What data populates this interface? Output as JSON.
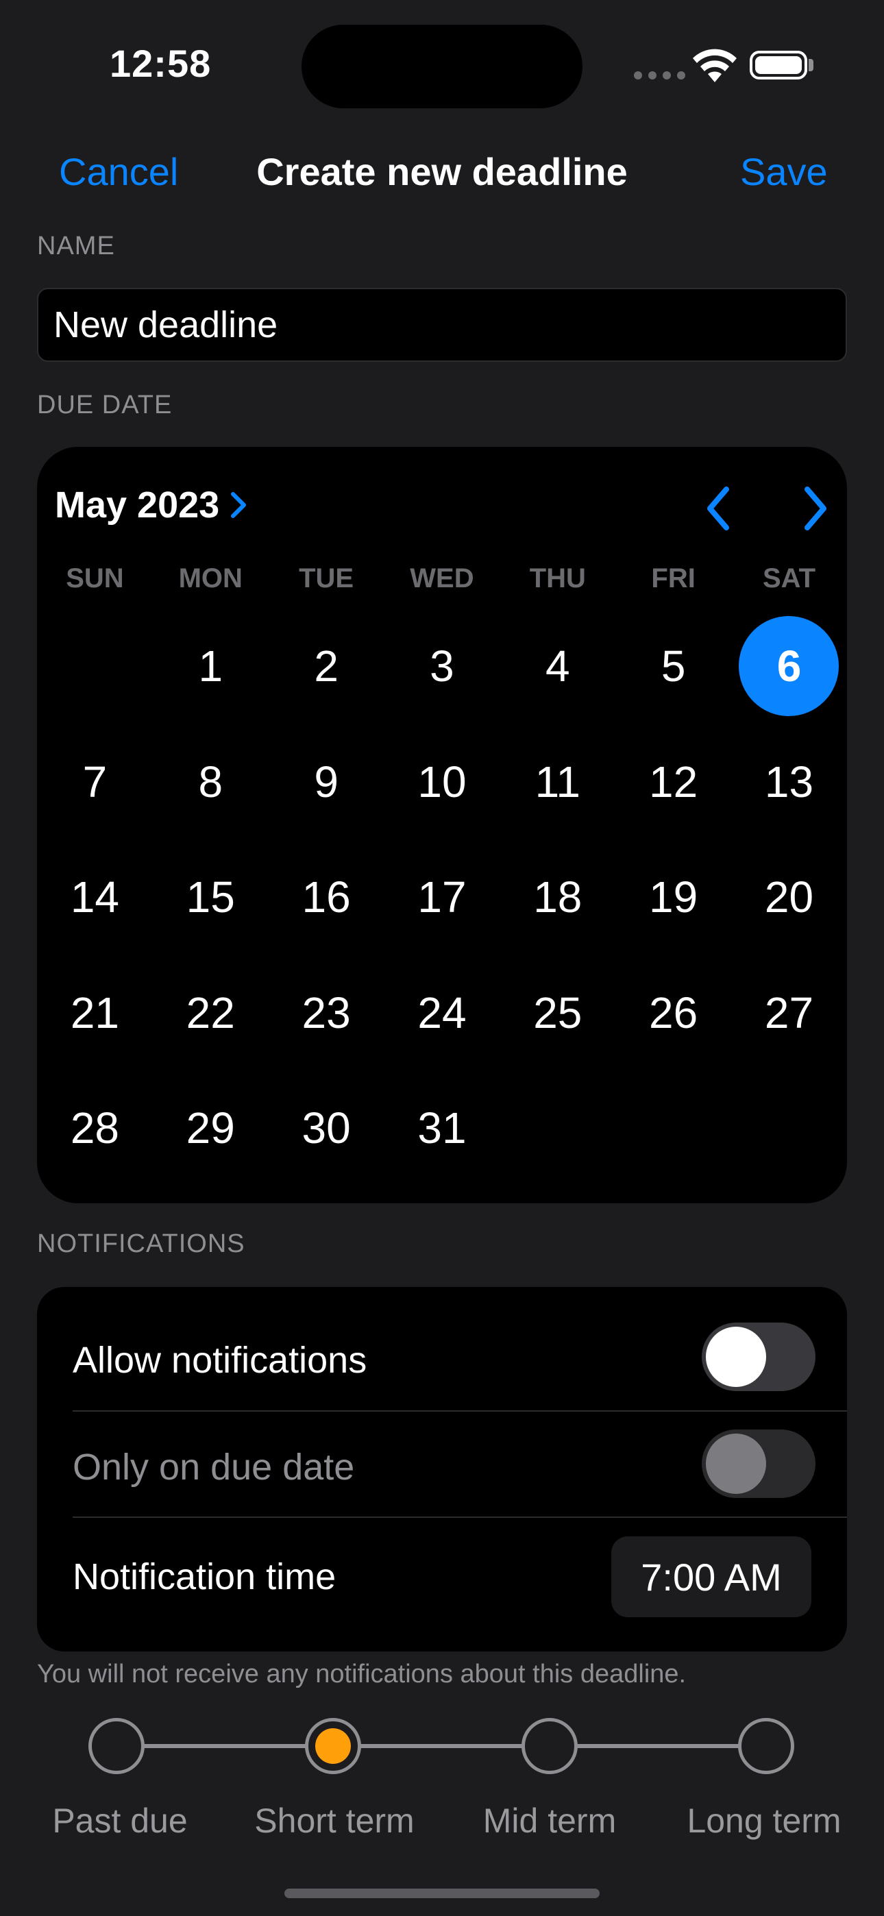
{
  "status_bar": {
    "time": "12:58"
  },
  "nav": {
    "cancel": "Cancel",
    "title": "Create new deadline",
    "save": "Save"
  },
  "name_section": {
    "label": "NAME",
    "value": "New deadline"
  },
  "due_date_section": {
    "label": "DUE DATE"
  },
  "calendar": {
    "month": "May 2023",
    "weekdays": [
      "SUN",
      "MON",
      "TUE",
      "WED",
      "THU",
      "FRI",
      "SAT"
    ],
    "first_weekday_index": 1,
    "days_in_month": 31,
    "selected_day": 6,
    "accent": "#0a84ff"
  },
  "notifications": {
    "label": "NOTIFICATIONS",
    "allow_label": "Allow notifications",
    "allow_on": false,
    "due_only_label": "Only on due date",
    "due_only_on": false,
    "time_label": "Notification time",
    "time_value": "7:00 AM",
    "footer": "You will not receive any notifications about this deadline."
  },
  "urgency": {
    "options": [
      "Past due",
      "Short term",
      "Mid term",
      "Long term"
    ],
    "selected": "Short term",
    "selected_color": "#ff9f0a"
  },
  "icons": {
    "month_chevron": "chevron-right-icon",
    "prev": "chevron-left-icon",
    "next": "chevron-right-icon",
    "wifi": "wifi-icon",
    "battery": "battery-icon"
  }
}
